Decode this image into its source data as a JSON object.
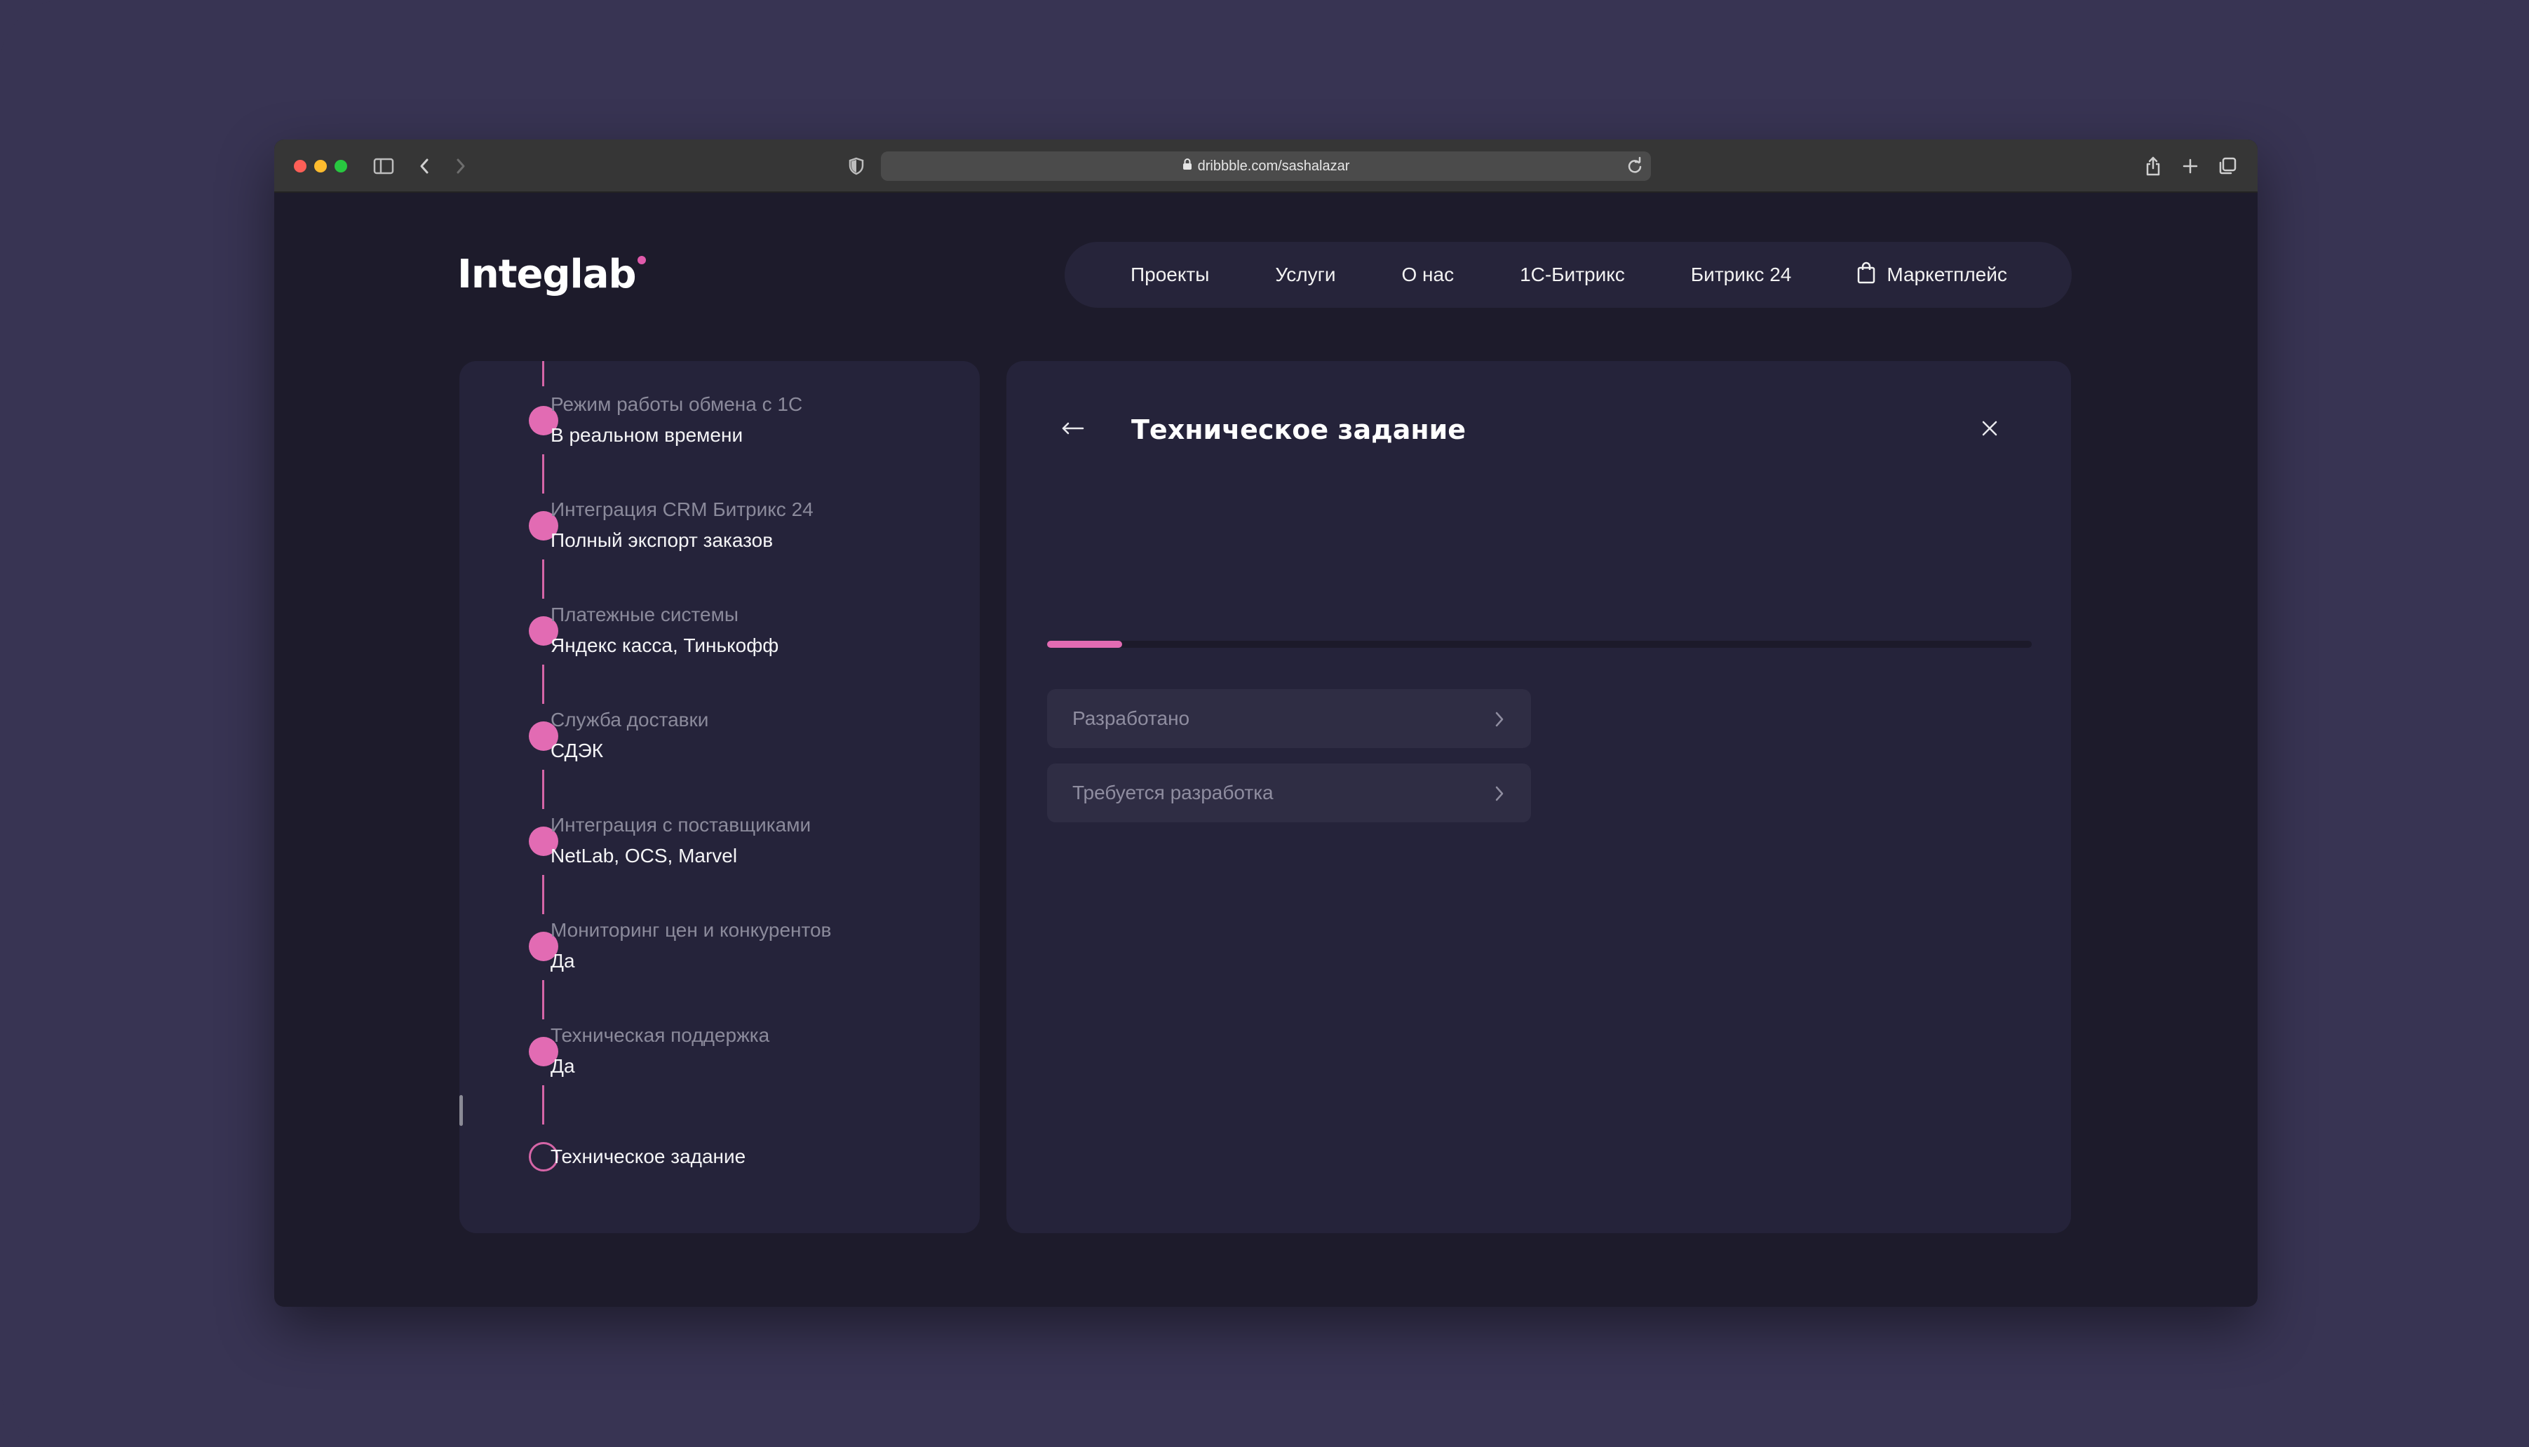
{
  "browser": {
    "url": "dribbble.com/sashalazar",
    "icons": [
      "close-dot",
      "minimize-dot",
      "maximize-dot",
      "sidebar-icon",
      "back-icon",
      "forward-icon",
      "shield-icon",
      "lock-icon",
      "reload-icon",
      "share-icon",
      "new-tab-icon",
      "tabs-overview-icon"
    ]
  },
  "header": {
    "logo": "Integlab",
    "nav": [
      {
        "label": "Проекты"
      },
      {
        "label": "Услуги"
      },
      {
        "label": "О нас"
      },
      {
        "label": "1С-Битрикс"
      },
      {
        "label": "Битрикс 24"
      },
      {
        "label": "Маркетплейс",
        "icon": "bag-icon"
      }
    ]
  },
  "steps": [
    {
      "label": "Режим работы обмена с 1С",
      "value": "В реальном времени"
    },
    {
      "label": "Интеграция CRM Битрикс 24",
      "value": "Полный экспорт заказов"
    },
    {
      "label": "Платежные системы",
      "value": "Яндекс касса, Тинькофф"
    },
    {
      "label": "Служба доставки",
      "value": "СДЭК"
    },
    {
      "label": "Интеграция с поставщиками",
      "value": "NetLab, OCS, Marvel"
    },
    {
      "label": "Мониторинг цен и конкурентов",
      "value": "Да"
    },
    {
      "label": "Техническая поддержка",
      "value": "Да"
    },
    {
      "label": "Техническое задание",
      "value": ""
    }
  ],
  "panel": {
    "title": "Техническое задание",
    "progress_fraction": 0.076,
    "options": [
      {
        "label": "Разработано"
      },
      {
        "label": "Требуется разработка"
      }
    ]
  },
  "colors": {
    "accent": "#e26bb3",
    "background": "#1d1b2b",
    "panel": "#25233a",
    "outer": "#383453"
  }
}
